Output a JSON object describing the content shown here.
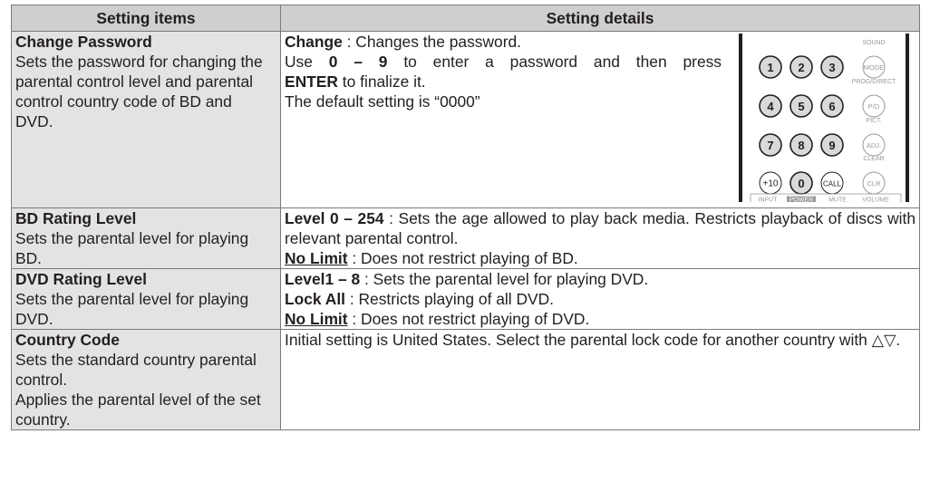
{
  "header": {
    "col1": "Setting items",
    "col2": "Setting details"
  },
  "rows": [
    {
      "title": "Change Password",
      "desc": "Sets the password for changing the parental control level and parental control country code of BD and DVD.",
      "details": [
        {
          "bold": "Change",
          "text": " : Changes the password."
        },
        {
          "pre": "Use ",
          "bold": "0 – 9",
          "text": " to enter a password and then press"
        },
        {
          "bold": "ENTER",
          "text": " to finalize it."
        },
        {
          "text": "The default setting is “0000”"
        }
      ]
    },
    {
      "title": "BD Rating Level",
      "desc": "Sets the parental level for playing BD.",
      "details": [
        {
          "bold": "Level 0 – 254",
          "text": " : Sets the age allowed to play back media. Restricts playback of discs with relevant parental control."
        },
        {
          "underline": "No Limit",
          "text": " : Does not restrict playing of BD."
        }
      ]
    },
    {
      "title": "DVD Rating Level",
      "desc": "Sets the parental level for playing DVD.",
      "details": [
        {
          "bold": "Level1 – 8",
          "text": " : Sets the parental level for playing DVD."
        },
        {
          "bold": "Lock All",
          "text": " : Restricts playing of all DVD."
        },
        {
          "underline": "No Limit",
          "text": " : Does not restrict playing of DVD."
        }
      ]
    },
    {
      "title": "Country Code",
      "desc": "Sets the standard country parental control.\nApplies the parental level of the set country.",
      "details": [
        {
          "text": "Initial setting is United States. Select the parental lock code for another country with △▽."
        }
      ]
    }
  ],
  "remote": {
    "keys": [
      "1",
      "2",
      "3",
      "4",
      "5",
      "6",
      "7",
      "8",
      "9",
      "+10",
      "0",
      "CALL"
    ],
    "side_labels": [
      "SOUND",
      "PROG/DIRECT",
      "PICT.",
      "CLEAR"
    ],
    "side_keys": [
      "MODE",
      "P/D",
      "ADJ.",
      "CLR"
    ],
    "bottom_labels": [
      "INPUT",
      "POWER",
      "MUTE",
      "VOLUME"
    ]
  }
}
